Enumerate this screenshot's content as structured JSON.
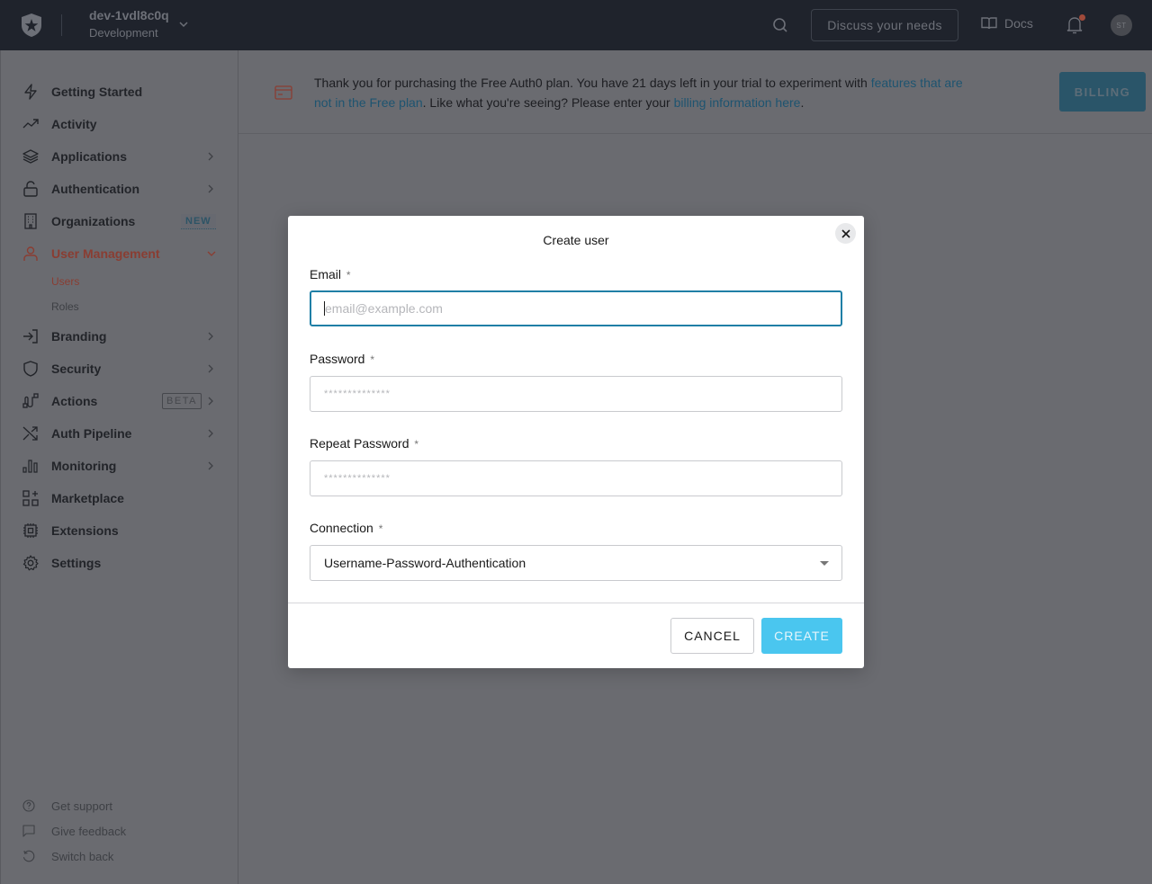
{
  "topbar": {
    "tenant_name": "dev-1vdl8c0q",
    "tenant_env": "Development",
    "discuss_label": "Discuss your needs",
    "docs_label": "Docs",
    "avatar_initials": "ST",
    "notification_dot_color": "#a04a3a"
  },
  "sidebar": {
    "items": [
      {
        "label": "Getting Started",
        "icon": "lightning-icon"
      },
      {
        "label": "Activity",
        "icon": "trending-up-icon"
      },
      {
        "label": "Applications",
        "icon": "layers-icon",
        "has_chevron": true
      },
      {
        "label": "Authentication",
        "icon": "lock-icon",
        "has_chevron": true
      },
      {
        "label": "Organizations",
        "icon": "building-icon",
        "badge": "NEW"
      },
      {
        "label": "User Management",
        "icon": "user-icon",
        "active": true,
        "expanded": true
      },
      {
        "label": "Branding",
        "icon": "sign-in-icon",
        "has_chevron": true
      },
      {
        "label": "Security",
        "icon": "shield-icon",
        "has_chevron": true
      },
      {
        "label": "Actions",
        "icon": "actions-flow-icon",
        "badge": "BETA",
        "has_chevron": true
      },
      {
        "label": "Auth Pipeline",
        "icon": "shuffle-icon",
        "has_chevron": true
      },
      {
        "label": "Monitoring",
        "icon": "bar-chart-icon",
        "has_chevron": true
      },
      {
        "label": "Marketplace",
        "icon": "grid-plus-icon"
      },
      {
        "label": "Extensions",
        "icon": "chip-icon"
      },
      {
        "label": "Settings",
        "icon": "gear-icon"
      }
    ],
    "sub_items": [
      {
        "label": "Users",
        "active": true
      },
      {
        "label": "Roles"
      }
    ],
    "footer": [
      {
        "label": "Get support",
        "icon": "help-circle-icon"
      },
      {
        "label": "Give feedback",
        "icon": "message-icon"
      },
      {
        "label": "Switch back",
        "icon": "rotate-ccw-icon"
      }
    ],
    "active_color": "#8a3d32"
  },
  "banner": {
    "text_1": "Thank you for purchasing the Free Auth0 plan. You have 21 days left in your trial to experiment with ",
    "link_1": "features that are not in the Free plan",
    "text_2": ". Like what you're seeing? Please enter your ",
    "link_2": "billing information here",
    "text_3": ".",
    "billing_label": "BILLING"
  },
  "modal": {
    "title": "Create user",
    "email_label": "Email",
    "email_placeholder": "email@example.com",
    "password_label": "Password",
    "password_placeholder": "**************",
    "repeat_password_label": "Repeat Password",
    "repeat_password_placeholder": "**************",
    "connection_label": "Connection",
    "connection_value": "Username-Password-Authentication",
    "required_mark": "*",
    "cancel_label": "CANCEL",
    "create_label": "CREATE",
    "accent_color": "#4ac6ef",
    "focus_color": "#1f7fa6"
  }
}
